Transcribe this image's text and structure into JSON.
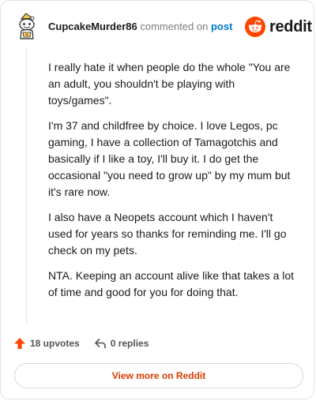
{
  "header": {
    "username": "CupcakeMurder86",
    "action_text": "commented on",
    "post_link": "post",
    "logo_word": "reddit"
  },
  "comment": {
    "paragraphs": [
      "I really hate it when people do the whole \"You are an adult, you shouldn't be playing with toys/games\".",
      "I'm 37 and childfree by choice. I love Legos, pc gaming, I have a collection of Tamagotchis and basically if I like a toy, I'll buy it. I do get the occasional \"you need to grow up\" by my mum but it's rare now.",
      "I also have a Neopets account which I haven't used for years so thanks for reminding me. I'll go check on my pets.",
      "NTA. Keeping an account alive like that takes a lot of time and good for you for doing that."
    ]
  },
  "actions": {
    "upvotes": "18 upvotes",
    "replies": "0 replies",
    "upvote_icon": "upvote-arrow-icon",
    "reply_icon": "reply-arrow-icon"
  },
  "footer": {
    "view_more": "View more on Reddit"
  },
  "colors": {
    "brand": "#ff4500",
    "link": "#0079d3",
    "view_more_text": "#d93a00"
  }
}
